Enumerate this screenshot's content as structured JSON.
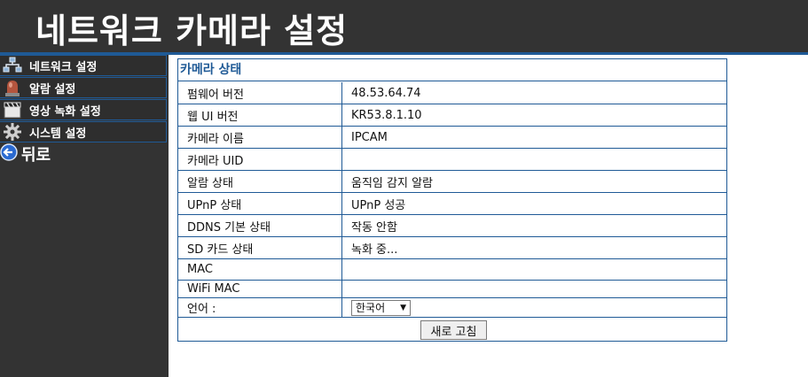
{
  "header": {
    "title": "네트워크 카메라 설정"
  },
  "sidebar": {
    "items": [
      {
        "label": "네트워크 설정",
        "icon": "network-icon"
      },
      {
        "label": "알람 설정",
        "icon": "alarm-icon"
      },
      {
        "label": "영상 녹화 설정",
        "icon": "video-record-icon"
      },
      {
        "label": "시스템 설정",
        "icon": "gear-icon"
      }
    ],
    "back_label": "뒤로"
  },
  "panel": {
    "title": "카메라 상태",
    "rows": [
      {
        "label": "펌웨어 버전",
        "value": "48.53.64.74"
      },
      {
        "label": "웹 UI 버전",
        "value": "KR53.8.1.10"
      },
      {
        "label": "카메라 이름",
        "value": "IPCAM"
      },
      {
        "label": "카메라 UID",
        "value": ""
      },
      {
        "label": "알람 상태",
        "value": "움직임 감지 알람"
      },
      {
        "label": "UPnP 상태",
        "value": "UPnP 성공"
      },
      {
        "label": "DDNS 기본 상태",
        "value": "작동 안함"
      },
      {
        "label": "SD 카드 상태",
        "value": "녹화 중..."
      },
      {
        "label": "MAC",
        "value": ""
      },
      {
        "label": "WiFi MAC",
        "value": ""
      }
    ],
    "language": {
      "label": "언어 :",
      "selected": "한국어"
    },
    "refresh_label": "새로 고침"
  },
  "colors": {
    "header_bg": "#333333",
    "accent": "#1f5a96",
    "sidebar_bg": "#333333"
  }
}
